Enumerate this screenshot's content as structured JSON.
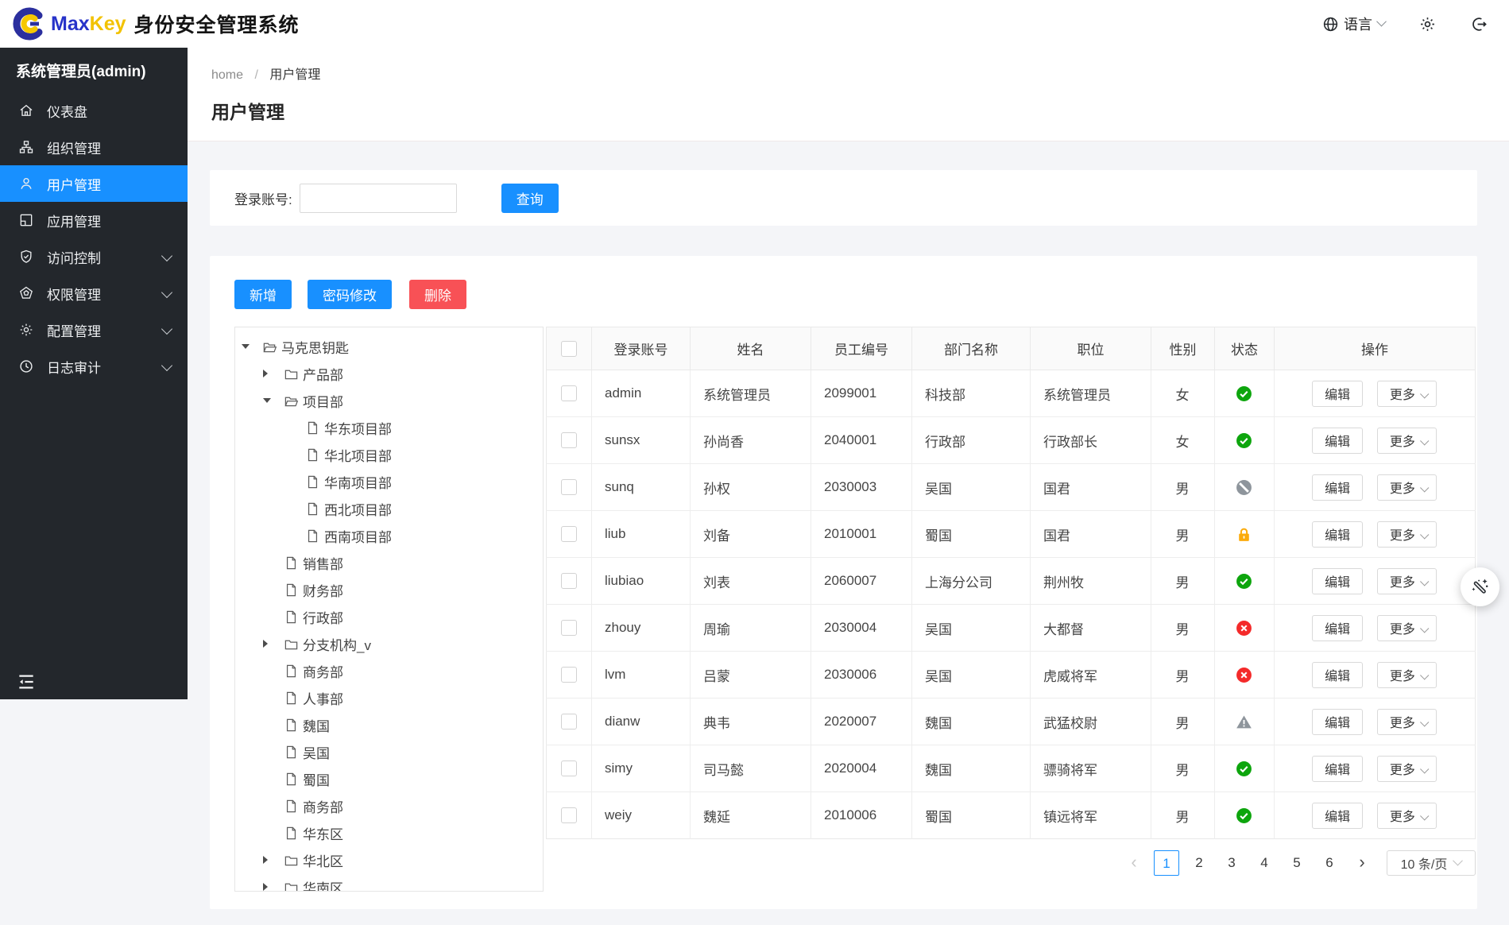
{
  "header": {
    "brand_max": "Max",
    "brand_key": "Key",
    "brand_cn": "身份安全管理系统",
    "language_label": "语言",
    "icons": [
      "globe-icon",
      "gear-icon",
      "logout-icon"
    ]
  },
  "sidebar": {
    "user_title": "系统管理员(admin)",
    "items": [
      {
        "id": "dashboard",
        "label": "仪表盘",
        "icon": "home-icon",
        "active": false,
        "expandable": false
      },
      {
        "id": "org",
        "label": "组织管理",
        "icon": "org-icon",
        "active": false,
        "expandable": false
      },
      {
        "id": "user",
        "label": "用户管理",
        "icon": "user-icon",
        "active": true,
        "expandable": false
      },
      {
        "id": "app",
        "label": "应用管理",
        "icon": "app-icon",
        "active": false,
        "expandable": false
      },
      {
        "id": "access",
        "label": "访问控制",
        "icon": "shield-icon",
        "active": false,
        "expandable": true
      },
      {
        "id": "permission",
        "label": "权限管理",
        "icon": "permission-icon",
        "active": false,
        "expandable": true
      },
      {
        "id": "config",
        "label": "配置管理",
        "icon": "config-icon",
        "active": false,
        "expandable": true
      },
      {
        "id": "audit",
        "label": "日志审计",
        "icon": "clock-icon",
        "active": false,
        "expandable": true
      }
    ]
  },
  "breadcrumb": {
    "home": "home",
    "separator": "/",
    "current": "用户管理"
  },
  "page": {
    "title": "用户管理"
  },
  "search": {
    "label": "登录账号:",
    "input_value": "",
    "query_button": "查询"
  },
  "toolbar": {
    "add": "新增",
    "change_password": "密码修改",
    "delete": "删除"
  },
  "tree": {
    "nodes": [
      {
        "level": 0,
        "caret": "down",
        "icon": "folder-open-icon",
        "label": "马克思钥匙"
      },
      {
        "level": 1,
        "caret": "right",
        "icon": "folder-closed-icon",
        "label": "产品部"
      },
      {
        "level": 1,
        "caret": "down",
        "icon": "folder-open-icon",
        "label": "项目部"
      },
      {
        "level": 2,
        "caret": "none",
        "icon": "file-icon",
        "label": "华东项目部"
      },
      {
        "level": 2,
        "caret": "none",
        "icon": "file-icon",
        "label": "华北项目部"
      },
      {
        "level": 2,
        "caret": "none",
        "icon": "file-icon",
        "label": "华南项目部"
      },
      {
        "level": 2,
        "caret": "none",
        "icon": "file-icon",
        "label": "西北项目部"
      },
      {
        "level": 2,
        "caret": "none",
        "icon": "file-icon",
        "label": "西南项目部"
      },
      {
        "level": 1,
        "caret": "none",
        "icon": "file-icon",
        "label": "销售部"
      },
      {
        "level": 1,
        "caret": "none",
        "icon": "file-icon",
        "label": "财务部"
      },
      {
        "level": 1,
        "caret": "none",
        "icon": "file-icon",
        "label": "行政部"
      },
      {
        "level": 1,
        "caret": "right",
        "icon": "folder-closed-icon",
        "label": "分支机构_v"
      },
      {
        "level": 1,
        "caret": "none",
        "icon": "file-icon",
        "label": "商务部"
      },
      {
        "level": 1,
        "caret": "none",
        "icon": "file-icon",
        "label": "人事部"
      },
      {
        "level": 1,
        "caret": "none",
        "icon": "file-icon",
        "label": "魏国"
      },
      {
        "level": 1,
        "caret": "none",
        "icon": "file-icon",
        "label": "吴国"
      },
      {
        "level": 1,
        "caret": "none",
        "icon": "file-icon",
        "label": "蜀国"
      },
      {
        "level": 1,
        "caret": "none",
        "icon": "file-icon",
        "label": "商务部"
      },
      {
        "level": 1,
        "caret": "none",
        "icon": "file-icon",
        "label": "华东区"
      },
      {
        "level": 1,
        "caret": "right",
        "icon": "folder-closed-icon",
        "label": "华北区"
      },
      {
        "level": 1,
        "caret": "right",
        "icon": "folder-closed-icon",
        "label": "华南区"
      }
    ]
  },
  "table": {
    "columns": [
      "登录账号",
      "姓名",
      "员工编号",
      "部门名称",
      "职位",
      "性别",
      "状态",
      "操作"
    ],
    "edit_label": "编辑",
    "more_label": "更多",
    "rows": [
      {
        "login": "admin",
        "name": "系统管理员",
        "emp_no": "2099001",
        "dept": "科技部",
        "position": "系统管理员",
        "gender": "女",
        "status": "active"
      },
      {
        "login": "sunsx",
        "name": "孙尚香",
        "emp_no": "2040001",
        "dept": "行政部",
        "position": "行政部长",
        "gender": "女",
        "status": "active"
      },
      {
        "login": "sunq",
        "name": "孙权",
        "emp_no": "2030003",
        "dept": "吴国",
        "position": "国君",
        "gender": "男",
        "status": "disabled"
      },
      {
        "login": "liub",
        "name": "刘备",
        "emp_no": "2010001",
        "dept": "蜀国",
        "position": "国君",
        "gender": "男",
        "status": "locked"
      },
      {
        "login": "liubiao",
        "name": "刘表",
        "emp_no": "2060007",
        "dept": "上海分公司",
        "position": "荆州牧",
        "gender": "男",
        "status": "active"
      },
      {
        "login": "zhouy",
        "name": "周瑜",
        "emp_no": "2030004",
        "dept": "吴国",
        "position": "大都督",
        "gender": "男",
        "status": "inactive"
      },
      {
        "login": "lvm",
        "name": "吕蒙",
        "emp_no": "2030006",
        "dept": "吴国",
        "position": "虎威将军",
        "gender": "男",
        "status": "inactive"
      },
      {
        "login": "dianw",
        "name": "典韦",
        "emp_no": "2020007",
        "dept": "魏国",
        "position": "武猛校尉",
        "gender": "男",
        "status": "warning"
      },
      {
        "login": "simy",
        "name": "司马懿",
        "emp_no": "2020004",
        "dept": "魏国",
        "position": "骠骑将军",
        "gender": "男",
        "status": "active"
      },
      {
        "login": "weiy",
        "name": "魏延",
        "emp_no": "2010006",
        "dept": "蜀国",
        "position": "镇远将军",
        "gender": "男",
        "status": "active"
      }
    ]
  },
  "pagination": {
    "prev": "‹",
    "next": "›",
    "pages": [
      "1",
      "2",
      "3",
      "4",
      "5",
      "6"
    ],
    "active_page": "1",
    "page_size_label": "10 条/页"
  },
  "fab": {
    "icon": "magic-wand-icon"
  },
  "colors": {
    "accent": "#1890ff",
    "danger": "#f85156",
    "sidebar_bg": "#23272c",
    "brand_blue": "#2733c9",
    "brand_yellow": "#f2c200",
    "status_active": "#0da50d",
    "status_inactive": "#f42a2a",
    "status_disabled": "#8e959c",
    "status_locked": "#fbab0c",
    "status_warning": "#8e959c"
  }
}
